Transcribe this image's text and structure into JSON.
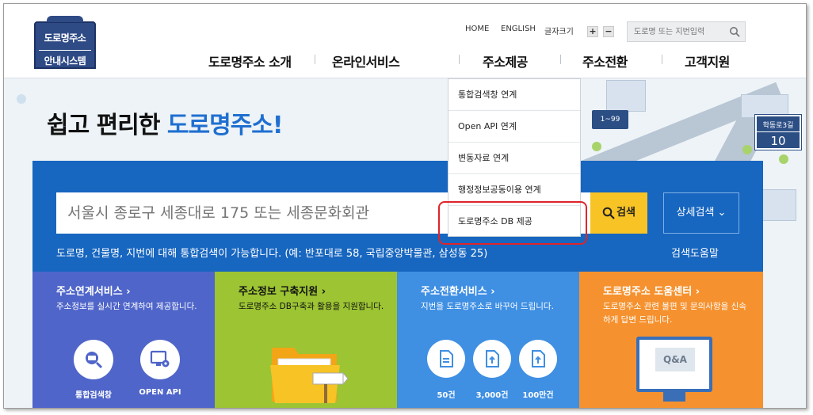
{
  "logo": {
    "line1": "도로명주소",
    "line2": "안내시스템"
  },
  "util": {
    "home": "HOME",
    "english": "ENGLISH",
    "font_size": "글자크기",
    "plus": "+",
    "minus": "−"
  },
  "top_search": {
    "placeholder": "도로명 또는 지번입력"
  },
  "gnb": [
    "도로명주소 소개",
    "온라인서비스",
    "주소제공",
    "주소전환",
    "고객지원"
  ],
  "dropdown": [
    "통합검색창 연계",
    "Open API 연계",
    "변동자료 연계",
    "행정정보공동이용 연계",
    "도로명주소 DB 제공"
  ],
  "hero": {
    "title_plain": "쉽고 편리한 ",
    "title_blue": "도로명주소!"
  },
  "city": {
    "street_sign": "1~99",
    "sign_top": "학동로3길",
    "sign_num": "10"
  },
  "search": {
    "placeholder": "서울시 종로구 세종대로 175 또는 세종문화회관",
    "button": "검색",
    "advanced": "상세검색 ⌄",
    "help": "도로명, 건물명, 지번에 대해 통합검색이 가능합니다. (예: 반포대로 58, 국립중앙박물관, 삼성동 25)",
    "help_link": "검색도움말"
  },
  "cards": [
    {
      "title": "주소연계서비스 ›",
      "desc": "주소정보를 실시간 연계하여 제공합니다.",
      "items": [
        "통합검색창",
        "OPEN API"
      ]
    },
    {
      "title": "주소정보 구축지원 ›",
      "desc": "도로명주소 DB구축과 활용을 지원합니다."
    },
    {
      "title": "주소전환서비스 ›",
      "desc": "지번을 도로명주소로 바꾸어 드립니다.",
      "items": [
        "50건",
        "3,000건",
        "100만건"
      ]
    },
    {
      "title": "도로명주소 도움센터 ›",
      "desc": "도로명주소 관련 불편 및 문의사항을 신속하게 답변 드립니다.",
      "badge": "Q&A"
    }
  ],
  "colors": {
    "primary_blue": "#1766c0",
    "accent_yellow": "#f7c325",
    "card1": "#4f65c9",
    "card2": "#9cc433",
    "card3": "#3f8fe3",
    "card4": "#f5922f",
    "highlight": "#e0242a"
  }
}
